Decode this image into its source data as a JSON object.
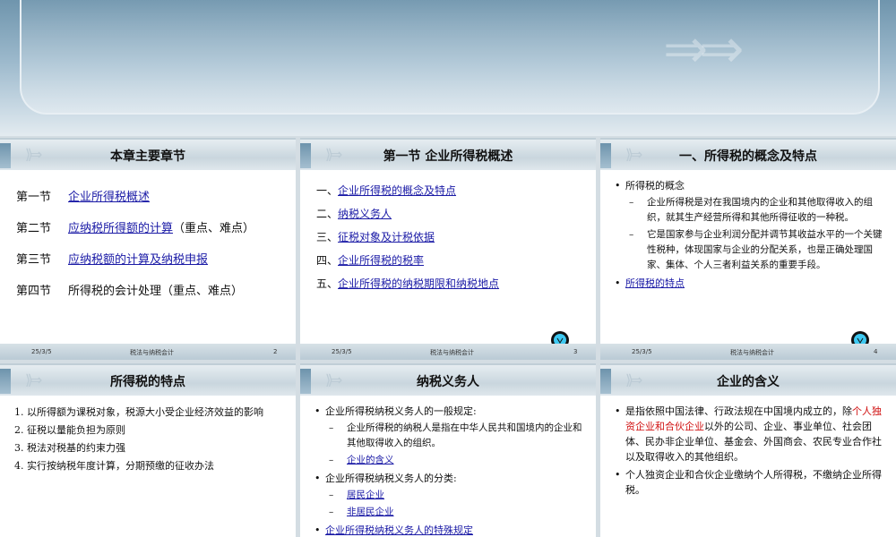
{
  "slides": [
    {
      "title": "本章主要章节",
      "footer": {
        "date": "25/3/5",
        "center": "税法与纳税会计",
        "page": "2"
      },
      "items": [
        {
          "k": "第一节",
          "link": "企业所得税概述",
          "rest": ""
        },
        {
          "k": "第二节",
          "link": "应纳税所得额的计算",
          "rest": "（重点、难点）"
        },
        {
          "k": "第三节",
          "link": "应纳税额的计算及纳税申报",
          "rest": ""
        },
        {
          "k": "第四节",
          "link": "",
          "rest": "所得税的会计处理（重点、难点）"
        }
      ]
    },
    {
      "title": "第一节  企业所得税概述",
      "footer": {
        "date": "25/3/5",
        "center": "税法与纳税会计",
        "page": "3"
      },
      "items": [
        {
          "k": "一、",
          "link": "企业所得税的概念及特点"
        },
        {
          "k": "二、",
          "link": "纳税义务人"
        },
        {
          "k": "三、",
          "link": "征税对象及计税依据"
        },
        {
          "k": "四、",
          "link": "企业所得税的税率"
        },
        {
          "k": "五、",
          "link": "企业所得税的纳税期限和纳税地点"
        }
      ]
    },
    {
      "title": "一、所得税的概念及特点",
      "footer": {
        "date": "25/3/5",
        "center": "税法与纳税会计",
        "page": "4"
      },
      "b1": "所得税的概念",
      "sub1": "企业所得税是对在我国境内的企业和其他取得收入的组织，就其生产经营所得和其他所得征收的一种税。",
      "sub2": "它是国家参与企业利润分配并调节其收益水平的一个关键性税种，体现国家与企业的分配关系，也是正确处理国家、集体、个人三者利益关系的重要手段。",
      "link": "所得税的特点"
    },
    {
      "title": "所得税的特点",
      "items": [
        "1. 以所得额为课税对象，税源大小受企业经济效益的影响",
        "2. 征税以量能负担为原则",
        "3. 税法对税基的约束力强",
        "4. 实行按纳税年度计算，分期预缴的征收办法"
      ]
    },
    {
      "title": "纳税义务人",
      "b1": "企业所得税纳税义务人的一般规定:",
      "s1": "企业所得税的纳税人是指在中华人民共和国境内的企业和其他取得收入的组织。",
      "s2": "企业的含义",
      "b2": "企业所得税纳税义务人的分类:",
      "s3": "居民企业",
      "s4": "非居民企业",
      "b3": "企业所得税纳税义务人的特殊规定"
    },
    {
      "title": "企业的含义",
      "p1a": "是指依照中国法律、行政法规在中国境内成立的，除",
      "p1red": "个人独资企业和合伙企业",
      "p1b": "以外的公司、企业、事业单位、社会团体、民办非企业单位、基金会、外国商会、农民专业合作社以及取得收入的其他组织。",
      "p2": "个人独资企业和合伙企业缴纳个人所得税，不缴纳企业所得税。"
    }
  ],
  "colors": {
    "link": "#1a1aa6",
    "highlight": "#d01010"
  }
}
